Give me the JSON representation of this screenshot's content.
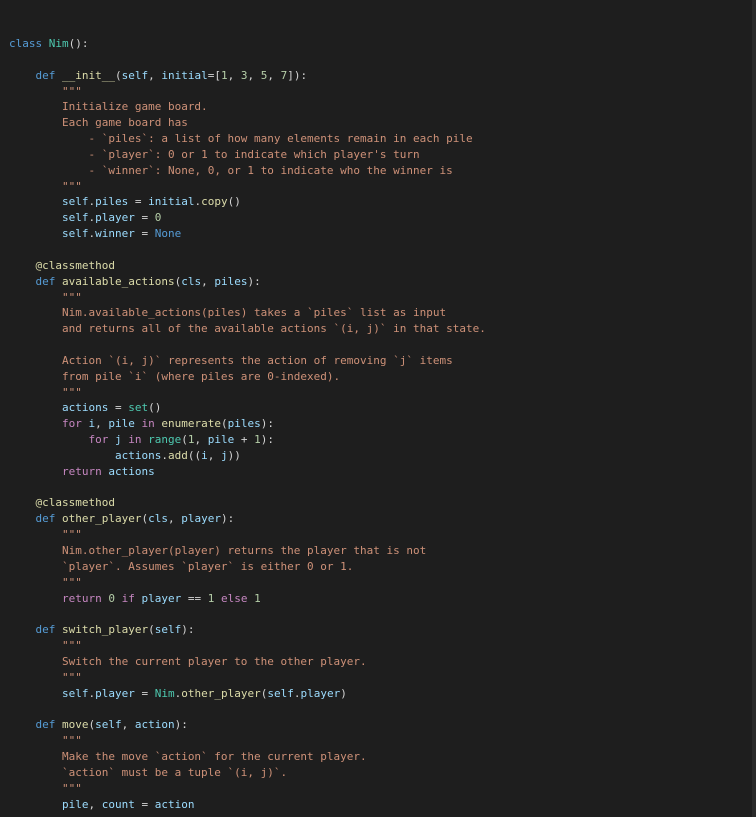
{
  "editor": {
    "language": "python",
    "theme_colors": {
      "background": "#1e1e1e",
      "keyword": "#569cd6",
      "control": "#c586c0",
      "class_name": "#4ec9b0",
      "function": "#dcdcaa",
      "variable": "#9cdcfe",
      "number": "#b5cea8",
      "string": "#ce9178",
      "text": "#d4d4d4"
    },
    "lines": [
      [
        {
          "t": "kw",
          "s": "class"
        },
        {
          "t": "plain",
          "s": " "
        },
        {
          "t": "cls",
          "s": "Nim"
        },
        {
          "t": "plain",
          "s": "():"
        }
      ],
      [],
      [
        {
          "t": "plain",
          "s": "    "
        },
        {
          "t": "kw",
          "s": "def"
        },
        {
          "t": "plain",
          "s": " "
        },
        {
          "t": "fn",
          "s": "__init__"
        },
        {
          "t": "plain",
          "s": "("
        },
        {
          "t": "var",
          "s": "self"
        },
        {
          "t": "plain",
          "s": ", "
        },
        {
          "t": "var",
          "s": "initial"
        },
        {
          "t": "plain",
          "s": "=["
        },
        {
          "t": "num",
          "s": "1"
        },
        {
          "t": "plain",
          "s": ", "
        },
        {
          "t": "num",
          "s": "3"
        },
        {
          "t": "plain",
          "s": ", "
        },
        {
          "t": "num",
          "s": "5"
        },
        {
          "t": "plain",
          "s": ", "
        },
        {
          "t": "num",
          "s": "7"
        },
        {
          "t": "plain",
          "s": "]):"
        }
      ],
      [
        {
          "t": "plain",
          "s": "        "
        },
        {
          "t": "str",
          "s": "\"\"\""
        }
      ],
      [
        {
          "t": "plain",
          "s": "        "
        },
        {
          "t": "str",
          "s": "Initialize game board."
        }
      ],
      [
        {
          "t": "plain",
          "s": "        "
        },
        {
          "t": "str",
          "s": "Each game board has"
        }
      ],
      [
        {
          "t": "plain",
          "s": "            "
        },
        {
          "t": "str",
          "s": "- `piles`: a list of how many elements remain in each pile"
        }
      ],
      [
        {
          "t": "plain",
          "s": "            "
        },
        {
          "t": "str",
          "s": "- `player`: 0 or 1 to indicate which player's turn"
        }
      ],
      [
        {
          "t": "plain",
          "s": "            "
        },
        {
          "t": "str",
          "s": "- `winner`: None, 0, or 1 to indicate who the winner is"
        }
      ],
      [
        {
          "t": "plain",
          "s": "        "
        },
        {
          "t": "str",
          "s": "\"\"\""
        }
      ],
      [
        {
          "t": "plain",
          "s": "        "
        },
        {
          "t": "var",
          "s": "self"
        },
        {
          "t": "plain",
          "s": "."
        },
        {
          "t": "var",
          "s": "piles"
        },
        {
          "t": "plain",
          "s": " = "
        },
        {
          "t": "var",
          "s": "initial"
        },
        {
          "t": "plain",
          "s": "."
        },
        {
          "t": "fn",
          "s": "copy"
        },
        {
          "t": "plain",
          "s": "()"
        }
      ],
      [
        {
          "t": "plain",
          "s": "        "
        },
        {
          "t": "var",
          "s": "self"
        },
        {
          "t": "plain",
          "s": "."
        },
        {
          "t": "var",
          "s": "player"
        },
        {
          "t": "plain",
          "s": " = "
        },
        {
          "t": "num",
          "s": "0"
        }
      ],
      [
        {
          "t": "plain",
          "s": "        "
        },
        {
          "t": "var",
          "s": "self"
        },
        {
          "t": "plain",
          "s": "."
        },
        {
          "t": "var",
          "s": "winner"
        },
        {
          "t": "plain",
          "s": " = "
        },
        {
          "t": "kw",
          "s": "None"
        }
      ],
      [],
      [
        {
          "t": "plain",
          "s": "    "
        },
        {
          "t": "fn",
          "s": "@classmethod"
        }
      ],
      [
        {
          "t": "plain",
          "s": "    "
        },
        {
          "t": "kw",
          "s": "def"
        },
        {
          "t": "plain",
          "s": " "
        },
        {
          "t": "fn",
          "s": "available_actions"
        },
        {
          "t": "plain",
          "s": "("
        },
        {
          "t": "var",
          "s": "cls"
        },
        {
          "t": "plain",
          "s": ", "
        },
        {
          "t": "var",
          "s": "piles"
        },
        {
          "t": "plain",
          "s": "):"
        }
      ],
      [
        {
          "t": "plain",
          "s": "        "
        },
        {
          "t": "str",
          "s": "\"\"\""
        }
      ],
      [
        {
          "t": "plain",
          "s": "        "
        },
        {
          "t": "str",
          "s": "Nim.available_actions(piles) takes a `piles` list as input"
        }
      ],
      [
        {
          "t": "plain",
          "s": "        "
        },
        {
          "t": "str",
          "s": "and returns all of the available actions `(i, j)` in that state."
        }
      ],
      [],
      [
        {
          "t": "plain",
          "s": "        "
        },
        {
          "t": "str",
          "s": "Action `(i, j)` represents the action of removing `j` items"
        }
      ],
      [
        {
          "t": "plain",
          "s": "        "
        },
        {
          "t": "str",
          "s": "from pile `i` (where piles are 0-indexed)."
        }
      ],
      [
        {
          "t": "plain",
          "s": "        "
        },
        {
          "t": "str",
          "s": "\"\"\""
        }
      ],
      [
        {
          "t": "plain",
          "s": "        "
        },
        {
          "t": "var",
          "s": "actions"
        },
        {
          "t": "plain",
          "s": " = "
        },
        {
          "t": "cls",
          "s": "set"
        },
        {
          "t": "plain",
          "s": "()"
        }
      ],
      [
        {
          "t": "plain",
          "s": "        "
        },
        {
          "t": "ctrl",
          "s": "for"
        },
        {
          "t": "plain",
          "s": " "
        },
        {
          "t": "var",
          "s": "i"
        },
        {
          "t": "plain",
          "s": ", "
        },
        {
          "t": "var",
          "s": "pile"
        },
        {
          "t": "plain",
          "s": " "
        },
        {
          "t": "ctrl",
          "s": "in"
        },
        {
          "t": "plain",
          "s": " "
        },
        {
          "t": "fn",
          "s": "enumerate"
        },
        {
          "t": "plain",
          "s": "("
        },
        {
          "t": "var",
          "s": "piles"
        },
        {
          "t": "plain",
          "s": "):"
        }
      ],
      [
        {
          "t": "plain",
          "s": "            "
        },
        {
          "t": "ctrl",
          "s": "for"
        },
        {
          "t": "plain",
          "s": " "
        },
        {
          "t": "var",
          "s": "j"
        },
        {
          "t": "plain",
          "s": " "
        },
        {
          "t": "ctrl",
          "s": "in"
        },
        {
          "t": "plain",
          "s": " "
        },
        {
          "t": "cls",
          "s": "range"
        },
        {
          "t": "plain",
          "s": "("
        },
        {
          "t": "num",
          "s": "1"
        },
        {
          "t": "plain",
          "s": ", "
        },
        {
          "t": "var",
          "s": "pile"
        },
        {
          "t": "plain",
          "s": " + "
        },
        {
          "t": "num",
          "s": "1"
        },
        {
          "t": "plain",
          "s": "):"
        }
      ],
      [
        {
          "t": "plain",
          "s": "                "
        },
        {
          "t": "var",
          "s": "actions"
        },
        {
          "t": "plain",
          "s": "."
        },
        {
          "t": "fn",
          "s": "add"
        },
        {
          "t": "plain",
          "s": "(("
        },
        {
          "t": "var",
          "s": "i"
        },
        {
          "t": "plain",
          "s": ", "
        },
        {
          "t": "var",
          "s": "j"
        },
        {
          "t": "plain",
          "s": "))"
        }
      ],
      [
        {
          "t": "plain",
          "s": "        "
        },
        {
          "t": "ctrl",
          "s": "return"
        },
        {
          "t": "plain",
          "s": " "
        },
        {
          "t": "var",
          "s": "actions"
        }
      ],
      [],
      [
        {
          "t": "plain",
          "s": "    "
        },
        {
          "t": "fn",
          "s": "@classmethod"
        }
      ],
      [
        {
          "t": "plain",
          "s": "    "
        },
        {
          "t": "kw",
          "s": "def"
        },
        {
          "t": "plain",
          "s": " "
        },
        {
          "t": "fn",
          "s": "other_player"
        },
        {
          "t": "plain",
          "s": "("
        },
        {
          "t": "var",
          "s": "cls"
        },
        {
          "t": "plain",
          "s": ", "
        },
        {
          "t": "var",
          "s": "player"
        },
        {
          "t": "plain",
          "s": "):"
        }
      ],
      [
        {
          "t": "plain",
          "s": "        "
        },
        {
          "t": "str",
          "s": "\"\"\""
        }
      ],
      [
        {
          "t": "plain",
          "s": "        "
        },
        {
          "t": "str",
          "s": "Nim.other_player(player) returns the player that is not"
        }
      ],
      [
        {
          "t": "plain",
          "s": "        "
        },
        {
          "t": "str",
          "s": "`player`. Assumes `player` is either 0 or 1."
        }
      ],
      [
        {
          "t": "plain",
          "s": "        "
        },
        {
          "t": "str",
          "s": "\"\"\""
        }
      ],
      [
        {
          "t": "plain",
          "s": "        "
        },
        {
          "t": "ctrl",
          "s": "return"
        },
        {
          "t": "plain",
          "s": " "
        },
        {
          "t": "num",
          "s": "0"
        },
        {
          "t": "plain",
          "s": " "
        },
        {
          "t": "ctrl",
          "s": "if"
        },
        {
          "t": "plain",
          "s": " "
        },
        {
          "t": "var",
          "s": "player"
        },
        {
          "t": "plain",
          "s": " == "
        },
        {
          "t": "num",
          "s": "1"
        },
        {
          "t": "plain",
          "s": " "
        },
        {
          "t": "ctrl",
          "s": "else"
        },
        {
          "t": "plain",
          "s": " "
        },
        {
          "t": "num",
          "s": "1"
        }
      ],
      [],
      [
        {
          "t": "plain",
          "s": "    "
        },
        {
          "t": "kw",
          "s": "def"
        },
        {
          "t": "plain",
          "s": " "
        },
        {
          "t": "fn",
          "s": "switch_player"
        },
        {
          "t": "plain",
          "s": "("
        },
        {
          "t": "var",
          "s": "self"
        },
        {
          "t": "plain",
          "s": "):"
        }
      ],
      [
        {
          "t": "plain",
          "s": "        "
        },
        {
          "t": "str",
          "s": "\"\"\""
        }
      ],
      [
        {
          "t": "plain",
          "s": "        "
        },
        {
          "t": "str",
          "s": "Switch the current player to the other player."
        }
      ],
      [
        {
          "t": "plain",
          "s": "        "
        },
        {
          "t": "str",
          "s": "\"\"\""
        }
      ],
      [
        {
          "t": "plain",
          "s": "        "
        },
        {
          "t": "var",
          "s": "self"
        },
        {
          "t": "plain",
          "s": "."
        },
        {
          "t": "var",
          "s": "player"
        },
        {
          "t": "plain",
          "s": " = "
        },
        {
          "t": "cls",
          "s": "Nim"
        },
        {
          "t": "plain",
          "s": "."
        },
        {
          "t": "fn",
          "s": "other_player"
        },
        {
          "t": "plain",
          "s": "("
        },
        {
          "t": "var",
          "s": "self"
        },
        {
          "t": "plain",
          "s": "."
        },
        {
          "t": "var",
          "s": "player"
        },
        {
          "t": "plain",
          "s": ")"
        }
      ],
      [],
      [
        {
          "t": "plain",
          "s": "    "
        },
        {
          "t": "kw",
          "s": "def"
        },
        {
          "t": "plain",
          "s": " "
        },
        {
          "t": "fn",
          "s": "move"
        },
        {
          "t": "plain",
          "s": "("
        },
        {
          "t": "var",
          "s": "self"
        },
        {
          "t": "plain",
          "s": ", "
        },
        {
          "t": "var",
          "s": "action"
        },
        {
          "t": "plain",
          "s": "):"
        }
      ],
      [
        {
          "t": "plain",
          "s": "        "
        },
        {
          "t": "str",
          "s": "\"\"\""
        }
      ],
      [
        {
          "t": "plain",
          "s": "        "
        },
        {
          "t": "str",
          "s": "Make the move `action` for the current player."
        }
      ],
      [
        {
          "t": "plain",
          "s": "        "
        },
        {
          "t": "str",
          "s": "`action` must be a tuple `(i, j)`."
        }
      ],
      [
        {
          "t": "plain",
          "s": "        "
        },
        {
          "t": "str",
          "s": "\"\"\""
        }
      ],
      [
        {
          "t": "plain",
          "s": "        "
        },
        {
          "t": "var",
          "s": "pile"
        },
        {
          "t": "plain",
          "s": ", "
        },
        {
          "t": "var",
          "s": "count"
        },
        {
          "t": "plain",
          "s": " = "
        },
        {
          "t": "var",
          "s": "action"
        }
      ]
    ]
  }
}
